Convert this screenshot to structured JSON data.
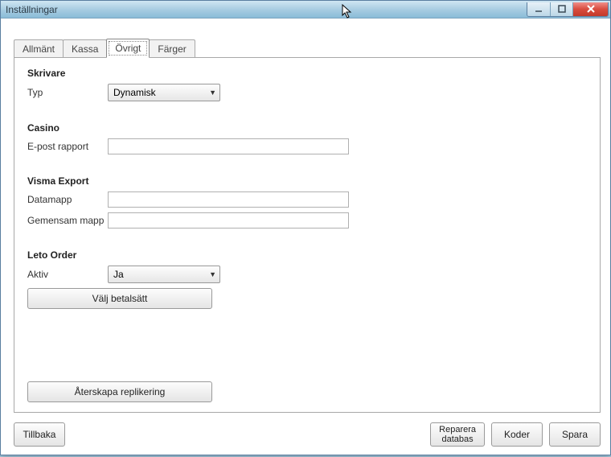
{
  "window": {
    "title": "Inställningar"
  },
  "tabs": {
    "allmant": "Allmänt",
    "kassa": "Kassa",
    "ovrigt": "Övrigt",
    "farger": "Färger",
    "active": "Övrigt"
  },
  "skrivare": {
    "heading": "Skrivare",
    "typ_label": "Typ",
    "typ_value": "Dynamisk"
  },
  "casino": {
    "heading": "Casino",
    "epost_label": "E-post rapport",
    "epost_value": ""
  },
  "visma": {
    "heading": "Visma Export",
    "datamapp_label": "Datamapp",
    "datamapp_value": "",
    "gemensam_label": "Gemensam mapp",
    "gemensam_value": ""
  },
  "leto": {
    "heading": "Leto Order",
    "aktiv_label": "Aktiv",
    "aktiv_value": "Ja",
    "valj_label": "Välj betalsätt"
  },
  "recreate_label": "Återskapa replikering",
  "footer": {
    "tillbaka": "Tillbaka",
    "reparera_l1": "Reparera",
    "reparera_l2": "databas",
    "koder": "Koder",
    "spara": "Spara"
  }
}
